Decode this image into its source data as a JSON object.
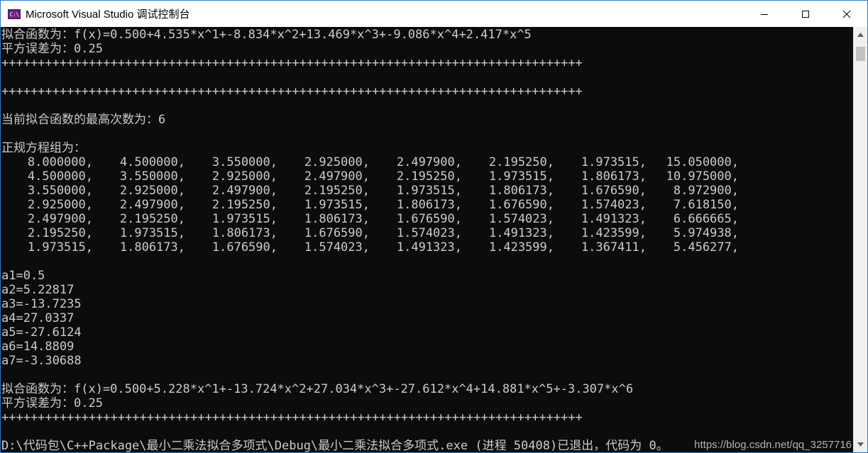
{
  "window": {
    "title": "Microsoft Visual Studio 调试控制台",
    "icon_label": "C:\\",
    "minimize_icon": "minimize-icon",
    "maximize_icon": "maximize-icon",
    "close_icon": "close-icon"
  },
  "console": {
    "lines_top": [
      "拟合函数为：f(x)=0.500+4.535*x^1+-8.834*x^2+13.469*x^3+-9.086*x^4+2.417*x^5",
      "平方误差为：0.25",
      "++++++++++++++++++++++++++++++++++++++++++++++++++++++++++++++++++++++++++++++++",
      "",
      "++++++++++++++++++++++++++++++++++++++++++++++++++++++++++++++++++++++++++++++++",
      "",
      "当前拟合函数的最高次数为：6",
      "",
      "正规方程组为："
    ],
    "matrix": [
      [
        "8.000000,",
        "4.500000,",
        "3.550000,",
        "2.925000,",
        "2.497900,",
        "2.195250,",
        "1.973515,",
        "15.050000,"
      ],
      [
        "4.500000,",
        "3.550000,",
        "2.925000,",
        "2.497900,",
        "2.195250,",
        "1.973515,",
        "1.806173,",
        "10.975000,"
      ],
      [
        "3.550000,",
        "2.925000,",
        "2.497900,",
        "2.195250,",
        "1.973515,",
        "1.806173,",
        "1.676590,",
        "8.972900,"
      ],
      [
        "2.925000,",
        "2.497900,",
        "2.195250,",
        "1.973515,",
        "1.806173,",
        "1.676590,",
        "1.574023,",
        "7.618150,"
      ],
      [
        "2.497900,",
        "2.195250,",
        "1.973515,",
        "1.806173,",
        "1.676590,",
        "1.574023,",
        "1.491323,",
        "6.666665,"
      ],
      [
        "2.195250,",
        "1.973515,",
        "1.806173,",
        "1.676590,",
        "1.574023,",
        "1.491323,",
        "1.423599,",
        "5.974938,"
      ],
      [
        "1.973515,",
        "1.806173,",
        "1.676590,",
        "1.574023,",
        "1.491323,",
        "1.423599,",
        "1.367411,",
        "5.456277,"
      ]
    ],
    "coefficients": [
      "a1=0.5",
      "a2=5.22817",
      "a3=-13.7235",
      "a4=27.0337",
      "a5=-27.6124",
      "a6=14.8809",
      "a7=-3.30688"
    ],
    "lines_bottom": [
      "拟合函数为：f(x)=0.500+5.228*x^1+-13.724*x^2+27.034*x^3+-27.612*x^4+14.881*x^5+-3.307*x^6",
      "平方误差为：0.25",
      "++++++++++++++++++++++++++++++++++++++++++++++++++++++++++++++++++++++++++++++++",
      "",
      "D:\\代码包\\C++Package\\最小二乘法拟合多项式\\Debug\\最小二乘法拟合多项式.exe (进程 50408)已退出，代码为 0。"
    ],
    "watermark": "https://blog.csdn.net/qq_3257716"
  },
  "colors": {
    "console_bg": "#0c0c0c",
    "console_text": "#cccccc",
    "titlebar_bg": "#ffffff",
    "window_border": "#2b79d8",
    "scrollbar_bg": "#f0f0f0",
    "scrollbar_thumb": "#c2c2c2"
  }
}
